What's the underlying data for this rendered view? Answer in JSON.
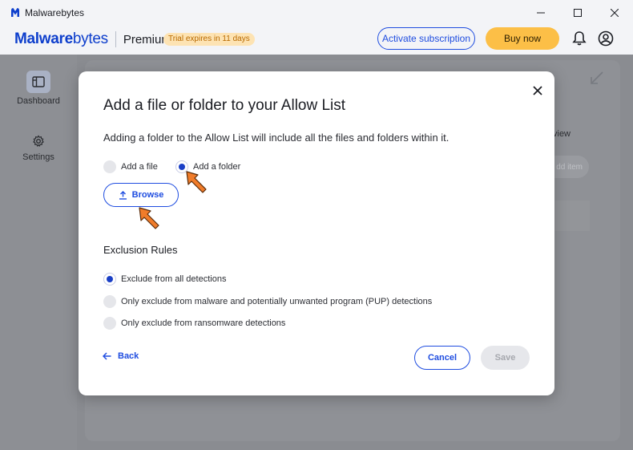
{
  "window": {
    "title": "Malwarebytes",
    "controls": [
      "minimize-icon",
      "maximize-icon",
      "close-icon"
    ]
  },
  "header": {
    "brand_bold": "Malware",
    "brand_light": "bytes",
    "edition": "Premium",
    "trial_badge": "Trial expires in 11 days",
    "activate_label": "Activate subscription",
    "buy_label": "Buy now",
    "icons": [
      "bell-icon",
      "account-icon"
    ]
  },
  "sidebar": {
    "items": [
      {
        "label": "Dashboard",
        "icon": "dashboard-icon",
        "active": true
      },
      {
        "label": "Settings",
        "icon": "gear-icon",
        "active": false
      }
    ]
  },
  "background": {
    "tab_fragment": "view",
    "pill_fragment": "dd item"
  },
  "modal": {
    "title": "Add a file or folder to your Allow List",
    "description": "Adding a folder to the Allow List will include all the files and folders within it.",
    "target_options": [
      {
        "label": "Add a file",
        "selected": false
      },
      {
        "label": "Add a folder",
        "selected": true
      }
    ],
    "browse_label": "Browse",
    "exclusion_title": "Exclusion Rules",
    "exclusion_options": [
      {
        "label": "Exclude from all detections",
        "selected": true
      },
      {
        "label": "Only exclude from malware and potentially unwanted program (PUP) detections",
        "selected": false
      },
      {
        "label": "Only exclude from ransomware detections",
        "selected": false
      }
    ],
    "back_label": "Back",
    "cancel_label": "Cancel",
    "save_label": "Save",
    "save_enabled": false
  },
  "colors": {
    "accent": "#1f4de0",
    "brand": "#0d3ecc",
    "buy": "#fcbf47",
    "trial_bg": "#fde3b3",
    "trial_text": "#b96a00",
    "pointer": "#f07c2a"
  }
}
